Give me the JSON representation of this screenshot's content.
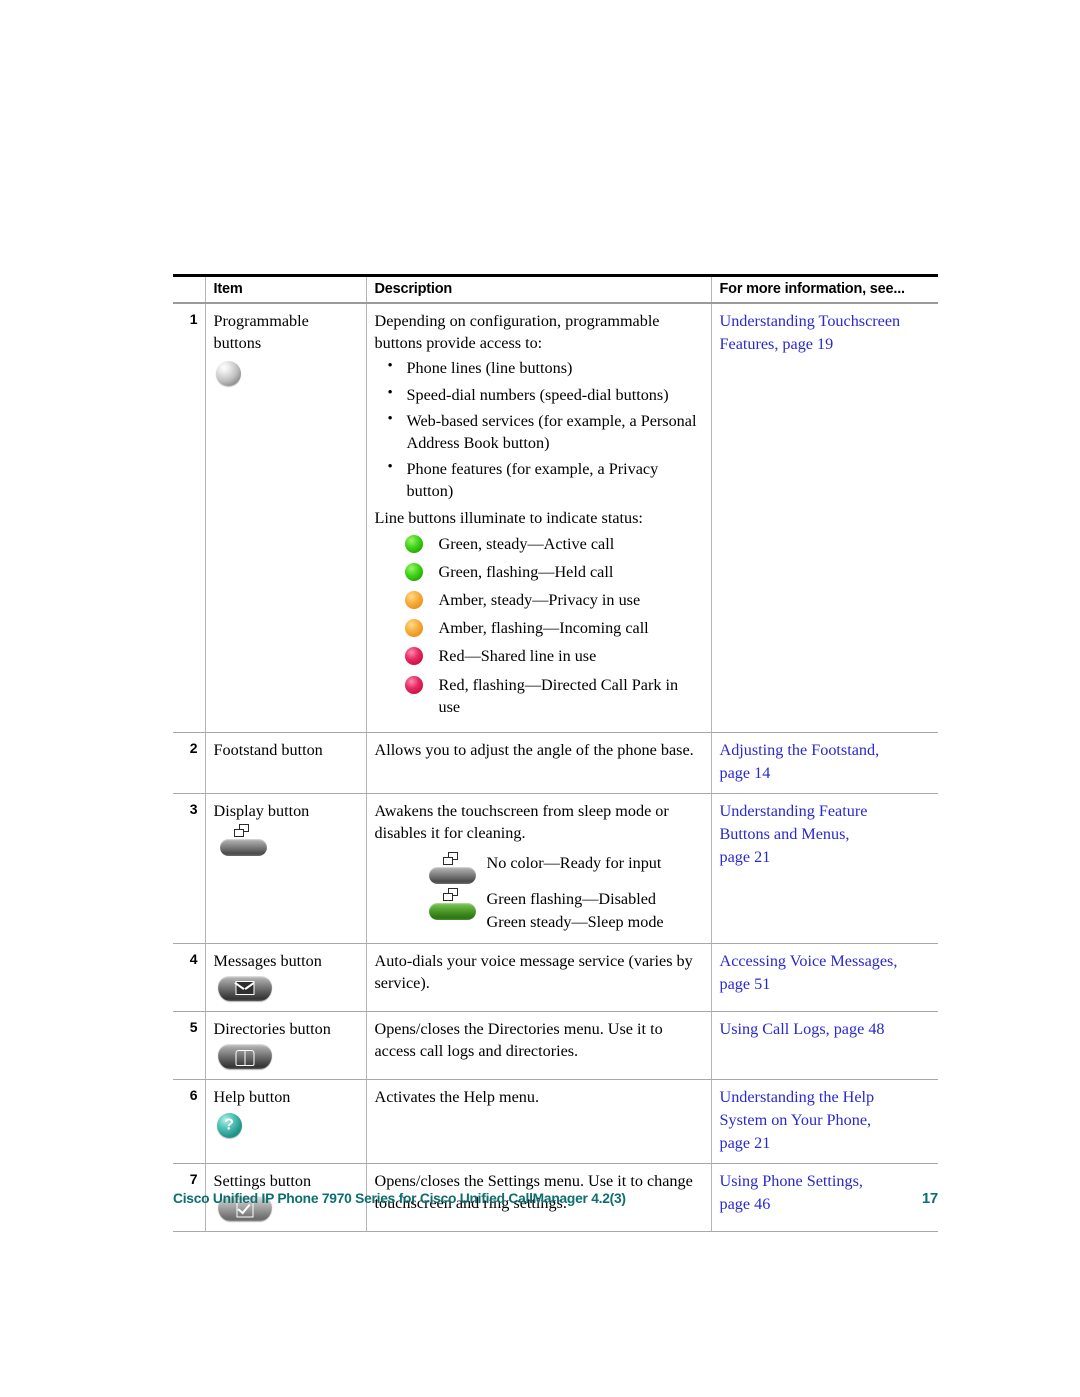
{
  "document": {
    "footer_text": "Cisco Unified IP Phone 7970 Series for Cisco Unified CallManager 4.2(3)",
    "page_number": "17",
    "footer_color": "#0d6f6d",
    "link_color": "#2a28cf"
  },
  "table": {
    "headers": {
      "num": "",
      "item": "Item",
      "description": "Description",
      "more": "For more information, see..."
    },
    "rows": [
      {
        "num": "1",
        "item": "Programmable buttons",
        "item_icon": "programmable-button-sphere-icon",
        "desc_lead": "Depending on configuration, programmable buttons provide access to:",
        "bullets": [
          "Phone lines (line buttons)",
          "Speed-dial numbers (speed-dial buttons)",
          "Web-based services (for example, a Personal Address Book button)",
          "Phone features (for example, a Privacy button)"
        ],
        "status_lead": "Line buttons illuminate to indicate status:",
        "leds": [
          {
            "color": "green",
            "hex": "#41d41a",
            "label": "Green, steady—Active call"
          },
          {
            "color": "green",
            "hex": "#41d41a",
            "label": "Green, flashing—Held call"
          },
          {
            "color": "amber",
            "hex": "#f7ae3c",
            "label": "Amber, steady—Privacy in use"
          },
          {
            "color": "amber",
            "hex": "#f7ae3c",
            "label": "Amber, flashing—Incoming call"
          },
          {
            "color": "red",
            "hex": "#e62a62",
            "label": "Red—Shared line in use"
          },
          {
            "color": "red",
            "hex": "#e62a62",
            "label": "Red, flashing—Directed Call Park in use"
          }
        ],
        "more": [
          "Understanding Touchscreen Features, page 19"
        ]
      },
      {
        "num": "2",
        "item": "Footstand button",
        "desc": "Allows you to adjust the angle of the phone base.",
        "more": [
          "Adjusting the Footstand,",
          "page 14"
        ]
      },
      {
        "num": "3",
        "item": "Display button",
        "item_icon": "display-button-pill-icon",
        "desc": "Awakens the touchscreen from sleep mode or disables it for cleaning.",
        "indicators": [
          {
            "art": "display-pill-gray",
            "label": "No color—Ready for input"
          },
          {
            "art": "display-pill-green",
            "label": "Green flashing—Disabled\nGreen steady—Sleep mode"
          }
        ],
        "more": [
          "Understanding Feature",
          "Buttons and Menus,",
          "page 21"
        ]
      },
      {
        "num": "4",
        "item": "Messages button",
        "item_icon": "messages-envelope-icon",
        "desc": "Auto-dials your voice message service (varies by service).",
        "more": [
          "Accessing Voice Messages,",
          "page 51"
        ]
      },
      {
        "num": "5",
        "item": "Directories button",
        "item_icon": "directories-book-icon",
        "desc": "Opens/closes the Directories menu. Use it to access call logs and directories.",
        "more": [
          "Using Call Logs, page 48"
        ]
      },
      {
        "num": "6",
        "item": "Help button",
        "item_icon": "help-question-icon",
        "desc": "Activates the Help menu.",
        "more": [
          "Understanding the Help",
          "System on Your Phone,",
          "page 21"
        ]
      },
      {
        "num": "7",
        "item": "Settings button",
        "item_icon": "settings-checkbox-icon",
        "desc": "Opens/closes the Settings menu. Use it to change touchscreen and ring settings.",
        "more": [
          "Using Phone Settings,",
          "page 46"
        ]
      }
    ]
  }
}
